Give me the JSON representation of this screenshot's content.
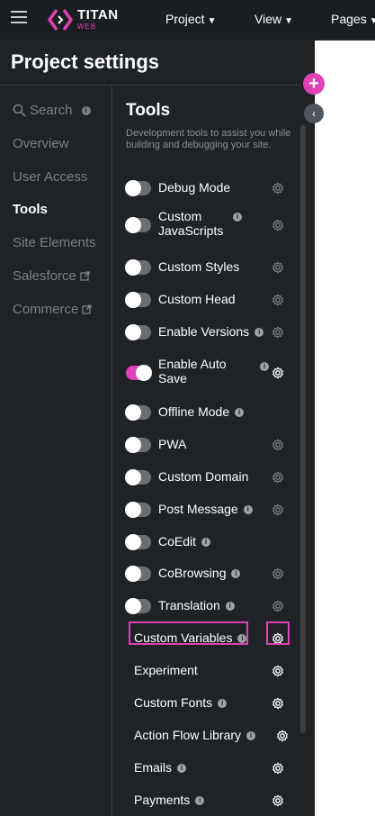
{
  "topbar": {
    "logo_text": "TITAN",
    "logo_sub": "WEB",
    "menus": [
      {
        "label": "Project"
      },
      {
        "label": "View"
      },
      {
        "label": "Pages"
      }
    ]
  },
  "panel": {
    "title": "Project settings",
    "nav": [
      {
        "label": "Search",
        "icon": "search-icon"
      },
      {
        "label": "Overview"
      },
      {
        "label": "User Access"
      },
      {
        "label": "Tools",
        "active": true
      },
      {
        "label": "Site Elements"
      },
      {
        "label": "Salesforce",
        "icon": "external-link-icon"
      },
      {
        "label": "Commerce",
        "icon": "external-link-icon"
      }
    ]
  },
  "tools": {
    "title": "Tools",
    "description": "Development tools to assist you while building and debugging your site.",
    "items": [
      {
        "label": "Debug Mode",
        "on": false,
        "info": false
      },
      {
        "label": "Custom JavaScripts",
        "on": false,
        "info": true
      },
      {
        "label": "Custom Styles",
        "on": false,
        "info": false
      },
      {
        "label": "Custom Head",
        "on": false,
        "info": false
      },
      {
        "label": "Enable Versions",
        "on": false,
        "info": true
      },
      {
        "label": "Enable Auto Save",
        "on": true,
        "info": true
      },
      {
        "label": "Offline Mode",
        "on": false,
        "info": true
      },
      {
        "label": "PWA",
        "on": false,
        "info": false
      },
      {
        "label": "Custom Domain",
        "on": false,
        "info": false
      },
      {
        "label": "Post Message",
        "on": false,
        "info": true
      },
      {
        "label": "CoEdit",
        "on": false,
        "info": true
      },
      {
        "label": "CoBrowsing",
        "on": false,
        "info": true
      },
      {
        "label": "Translation",
        "on": false,
        "info": true
      },
      {
        "label": "Custom Variables",
        "info": true
      },
      {
        "label": "Experiment",
        "info": false
      },
      {
        "label": "Custom Fonts",
        "info": true
      },
      {
        "label": "Action Flow Library",
        "info": true
      },
      {
        "label": "Emails",
        "info": true
      },
      {
        "label": "Payments",
        "info": true
      }
    ]
  },
  "colors": {
    "accent": "#e040b8",
    "panel_bg": "#1f2327",
    "topbar_bg": "#1b1e21"
  },
  "buttons": {
    "add": "+",
    "collapse": "‹"
  },
  "info_glyph": "i"
}
